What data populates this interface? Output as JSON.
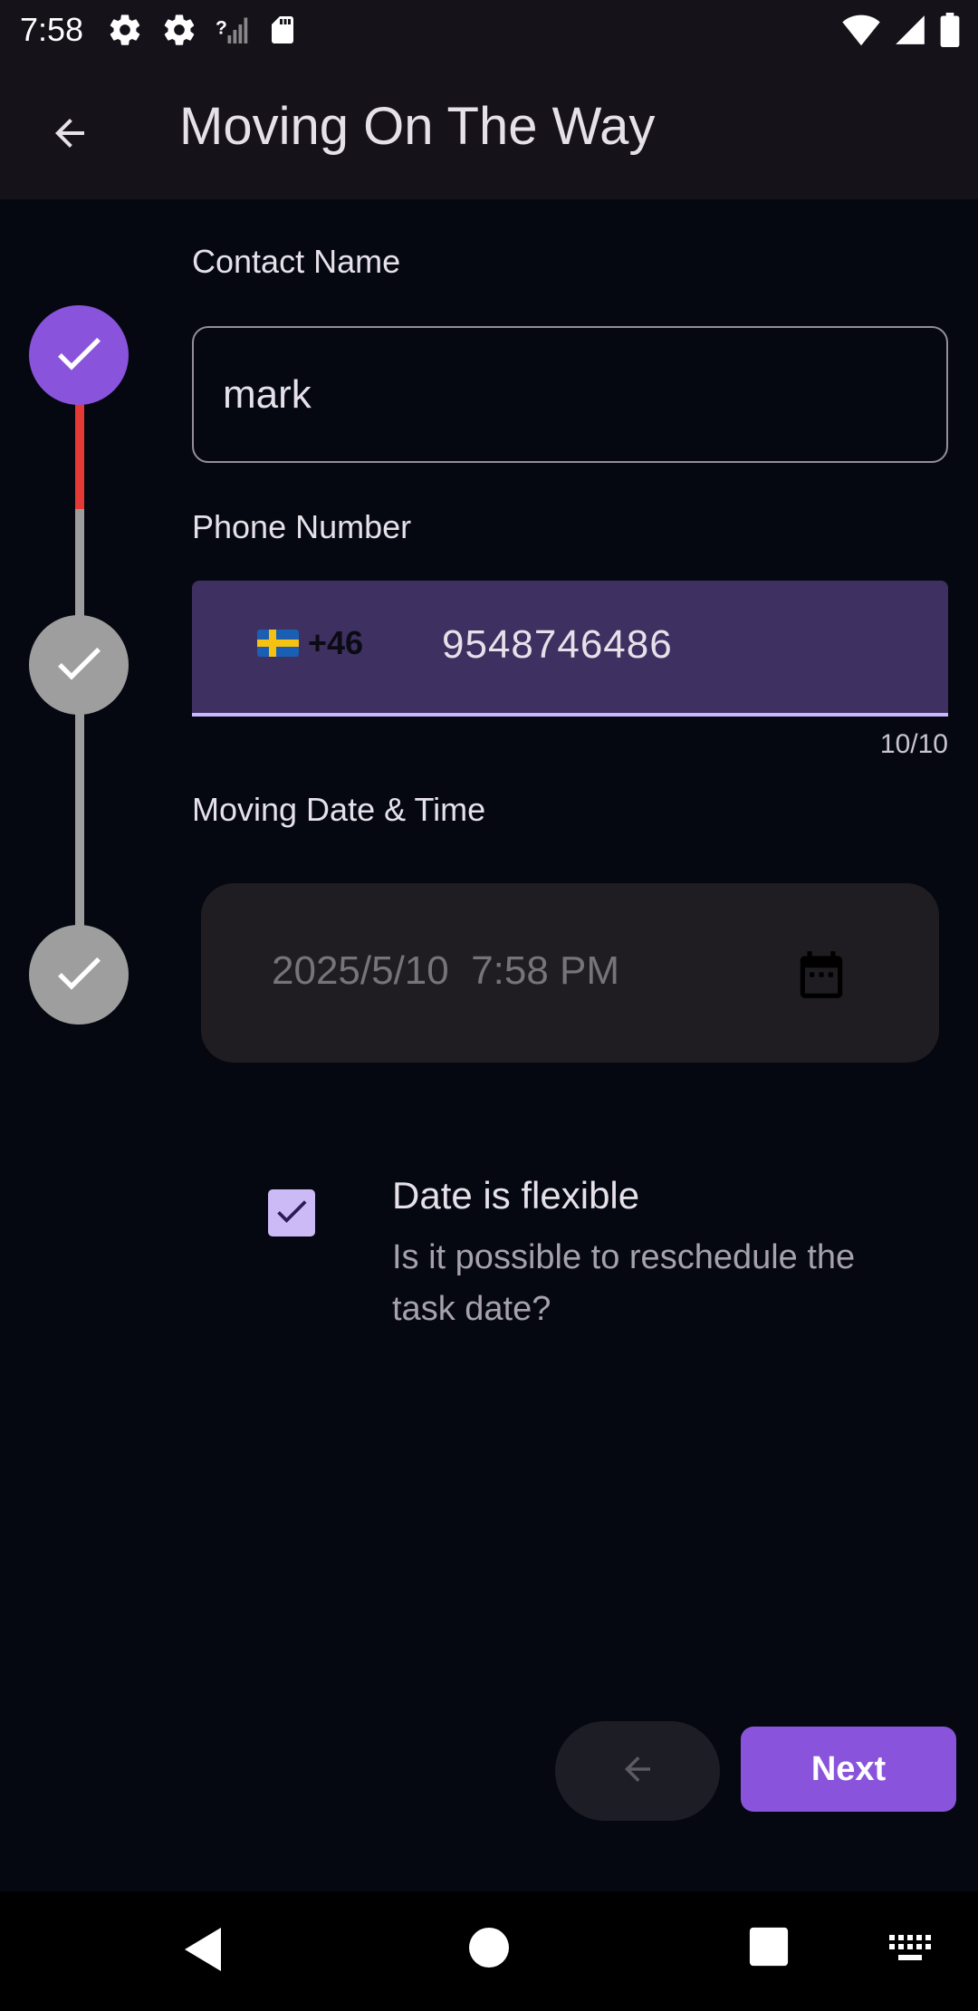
{
  "status_bar": {
    "time": "7:58",
    "left_icons": [
      "settings-icon",
      "settings-icon",
      "no-signal-icon",
      "sd-card-icon"
    ],
    "right_icons": [
      "wifi-icon",
      "signal-icon",
      "battery-icon"
    ]
  },
  "app_bar": {
    "title": "Moving On The Way",
    "back_icon": "arrow-back-icon"
  },
  "stepper": {
    "steps": [
      {
        "state": "active",
        "icon": "check-icon"
      },
      {
        "state": "completed",
        "icon": "check-icon"
      },
      {
        "state": "completed",
        "icon": "check-icon"
      }
    ],
    "colors": {
      "active": "#8a53dc",
      "inactive": "#9e9e9e",
      "connector_progress": "#e53935",
      "connector": "#9e9e9e"
    }
  },
  "form": {
    "contact_name": {
      "label": "Contact Name",
      "value": "mark"
    },
    "phone": {
      "label": "Phone Number",
      "country_flag": "sweden-flag-icon",
      "dial_code": "+46",
      "value": "9548746486",
      "counter": "10/10"
    },
    "moving_date": {
      "label": "Moving Date & Time",
      "value": "2025/5/10  7:58 PM",
      "icon": "calendar-icon"
    },
    "flexible": {
      "checked": true,
      "title": "Date is flexible",
      "subtitle": "Is it possible to reschedule the task date?"
    }
  },
  "actions": {
    "previous_icon": "arrow-back-icon",
    "next_label": "Next"
  },
  "nav_bar": {
    "buttons": [
      "back-triangle-icon",
      "home-circle-icon",
      "recents-square-icon",
      "keyboard-icon"
    ]
  },
  "colors": {
    "background": "#050811",
    "app_bar": "#15121a",
    "accent": "#8a53dc",
    "phone_field_bg": "#3f3062",
    "phone_field_underline": "#c7b8ff"
  }
}
